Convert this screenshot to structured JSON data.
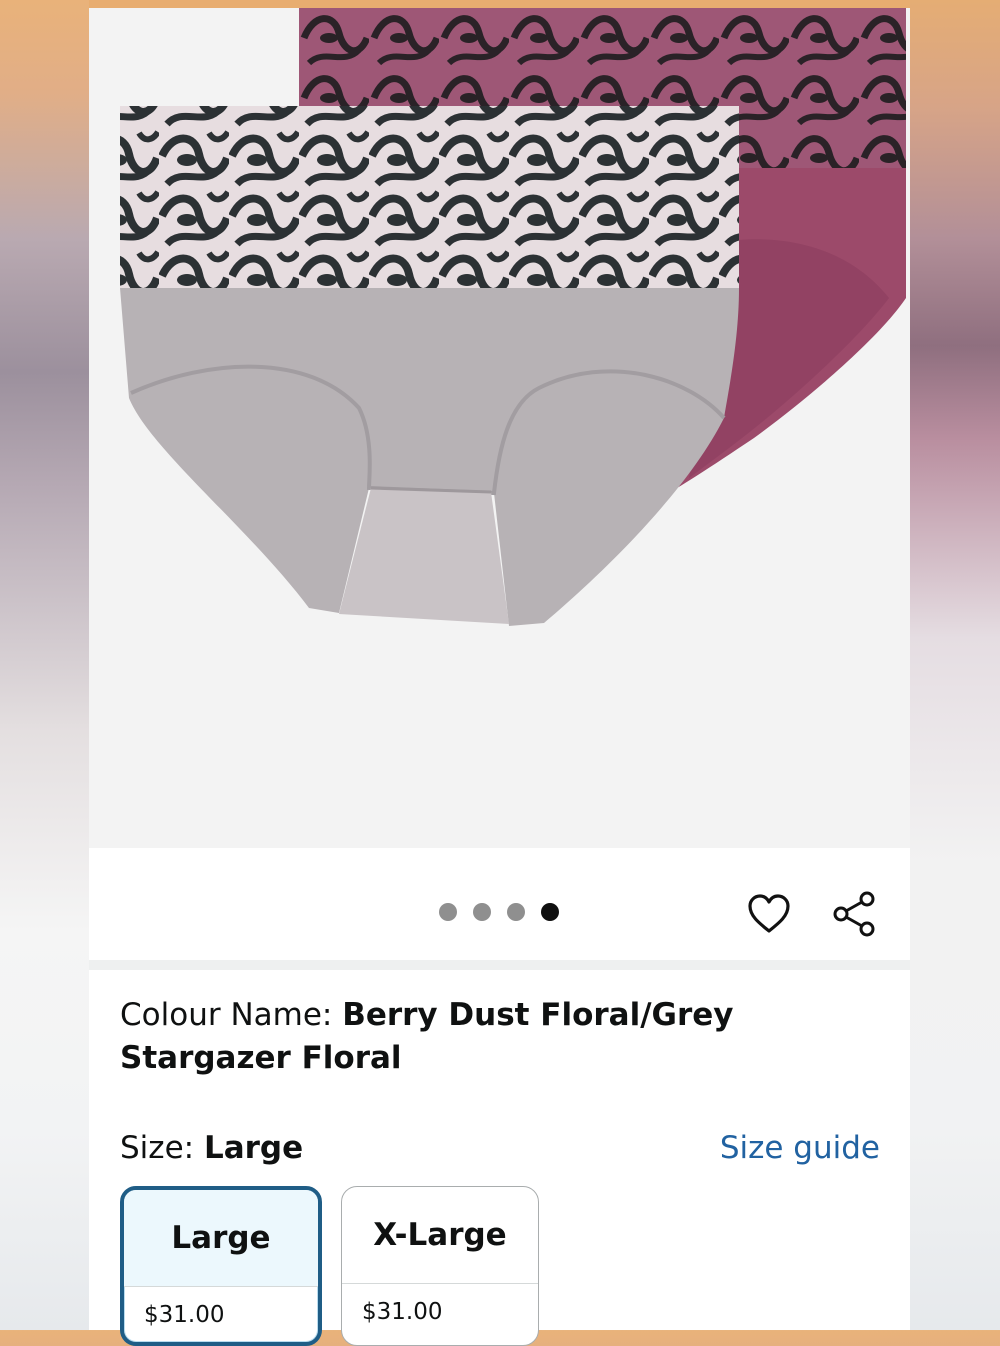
{
  "gallery": {
    "image_alt": "Two-pack high-waist seamless briefs, grey floral and berry floral",
    "dot_count": 4,
    "active_dot_index": 3,
    "wishlist_icon": "heart-outline-icon",
    "share_icon": "share-icon"
  },
  "colour": {
    "label": "Colour Name: ",
    "value": "Berry Dust Floral/Grey Stargazer Floral"
  },
  "size": {
    "label": "Size: ",
    "value": "Large",
    "guide_link": "Size guide",
    "options": [
      {
        "name": "Large",
        "price": "$31.00",
        "selected": true
      },
      {
        "name": "X-Large",
        "price": "$31.00",
        "selected": false
      }
    ]
  },
  "colors": {
    "accent_link": "#2162a1",
    "selected_border": "#1f5d86",
    "selected_fill": "#ecf8fd",
    "berry": "#9c4a6a",
    "grey": "#b7b2b5"
  }
}
